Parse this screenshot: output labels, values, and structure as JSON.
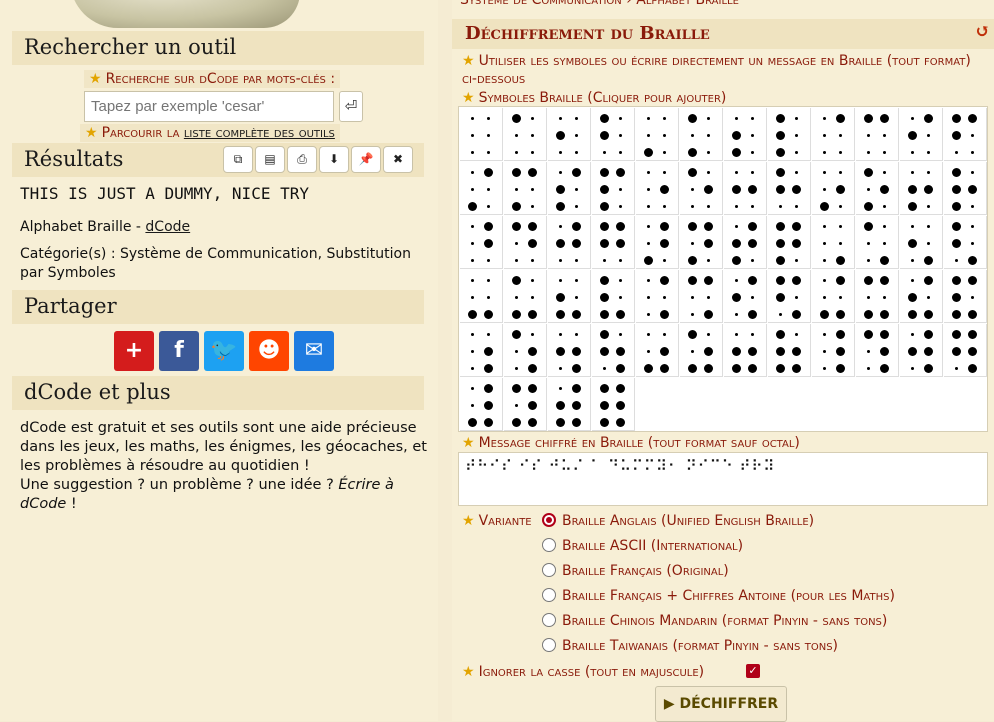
{
  "left": {
    "search_section_title": "Rechercher un outil",
    "search_keywords_label": "Recherche sur dCode par mots-clés :",
    "search_placeholder": "Tapez par exemple 'cesar'",
    "search_button": "⏎",
    "browse_prefix": "Parcourir la ",
    "browse_link": "liste complète des outils",
    "results_title": "Résultats",
    "result_text": "THIS IS JUST A DUMMY, NICE TRY",
    "result_source_prefix": "Alphabet Braille - ",
    "result_source_link": "dCode",
    "result_category": "Catégorie(s) : Système de Communication, Substitution par Symboles",
    "share_title": "Partager",
    "more_title": "dCode et plus",
    "more_text_1": "dCode est gratuit et ses outils sont une aide précieuse dans les jeux, les maths, les énigmes, les géocaches, et les problèmes à résoudre au quotidien !",
    "more_text_2": "Une suggestion ? un problème ? une idée ? ",
    "more_text_link": "Écrire à dCode",
    "more_text_end": " !"
  },
  "right": {
    "breadcrumb": "Système de Communication › Alphabet Braille",
    "title": "Déchiffrement du Braille",
    "instruction": "Utiliser les symboles ou écrire directement un message en Braille (tout format) ci-dessous",
    "symbols_label": "Symboles Braille (Cliquer pour ajouter)",
    "message_label": "Message chiffré en Braille (tout format sauf octal)",
    "message_value": "⠞⠓⠊⠎ ⠊⠎ ⠚⠥⠌ ⠁ ⠙⠥⠍⠍⠽⠂ ⠝⠊⠉⠑ ⠞⠗⠽",
    "variant_label": "Variante",
    "variants": [
      "Braille Anglais (Unified English Braille)",
      "Braille ASCII (International)",
      "Braille Français (Original)",
      "Braille Français + Chiffres Antoine (pour les Maths)",
      "Braille Chinois Mandarin (format Pinyin - sans tons)",
      "Braille Taiwanais (format Pinyin - sans tons)"
    ],
    "ignore_case_label": "Ignorer la casse (tout en majuscule)",
    "decipher_button": "▶ DÉCHIFFRER"
  }
}
